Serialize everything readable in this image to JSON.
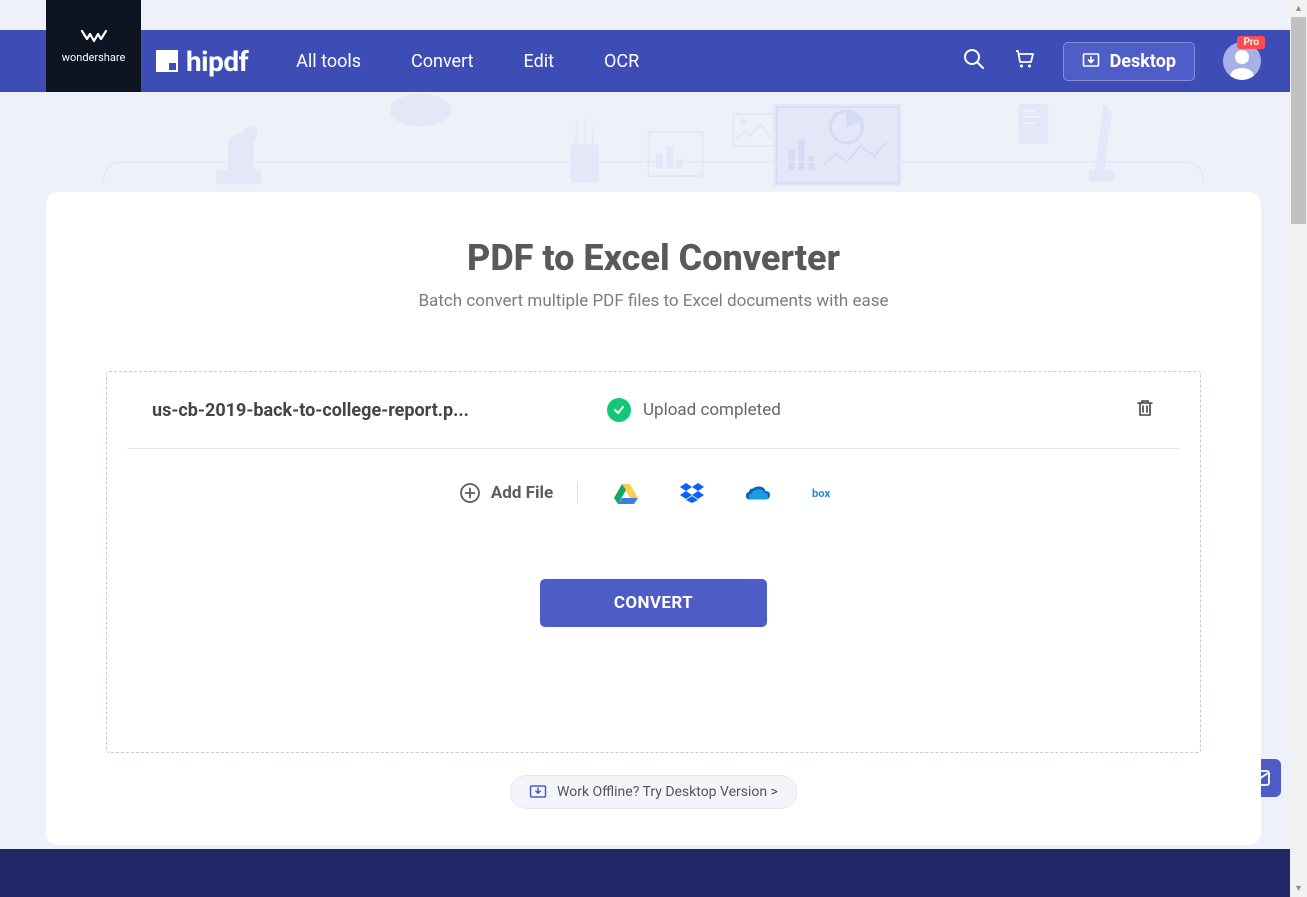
{
  "brand": {
    "parent": "wondershare",
    "name": "hipdf"
  },
  "nav": {
    "links": [
      "All tools",
      "Convert",
      "Edit",
      "OCR"
    ],
    "desktop_label": "Desktop",
    "pro_label": "Pro"
  },
  "page": {
    "title": "PDF to Excel Converter",
    "subtitle": "Batch convert multiple PDF files to Excel documents with ease"
  },
  "file": {
    "name": "us-cb-2019-back-to-college-report.p...",
    "status": "Upload completed"
  },
  "actions": {
    "add_file": "Add File",
    "convert": "CONVERT",
    "offline": "Work Offline? Try Desktop Version >"
  }
}
